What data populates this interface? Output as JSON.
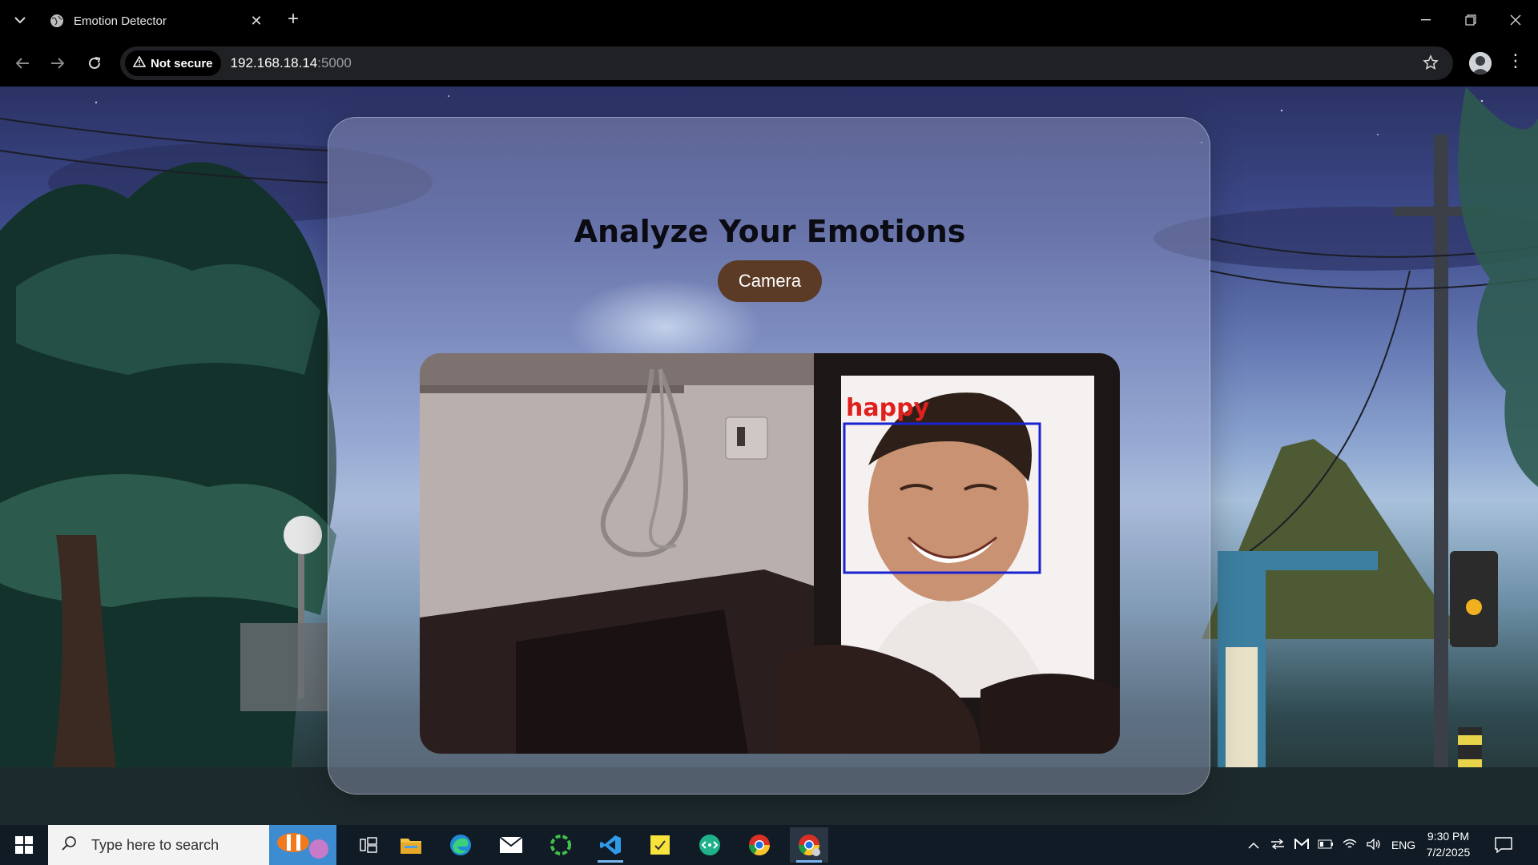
{
  "browser": {
    "tab_title": "Emotion Detector",
    "new_tab_symbol": "+",
    "security_label": "Not secure",
    "url_host": "192.168.18.14",
    "url_port": ":5000"
  },
  "page": {
    "heading": "Analyze Your Emotions",
    "camera_button": "Camera",
    "detection_label": "happy",
    "colors": {
      "button_bg": "#5c3b26",
      "box_color": "#1a22d0",
      "label_color": "#e0201c"
    }
  },
  "taskbar": {
    "search_placeholder": "Type here to search",
    "language": "ENG",
    "time": "9:30 PM",
    "date": "7/2/2025",
    "apps": [
      "task-view-icon",
      "file-explorer-icon",
      "edge-icon",
      "mail-icon",
      "green-circle-app-icon",
      "vscode-icon",
      "sticky-notes-icon",
      "remote-app-icon",
      "chrome-icon",
      "chrome-profile-icon"
    ]
  }
}
